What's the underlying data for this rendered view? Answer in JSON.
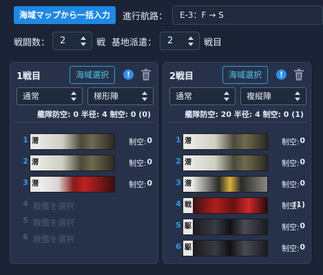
{
  "toolbar": {
    "import_button": "海域マップから一括入力",
    "route_label": "進行航路：",
    "route_value": "E-3：F → S",
    "battles_label": "戦闘数：",
    "battles_value": "2",
    "battles_suffix": "戦",
    "base_label": "基地派遣：",
    "base_value": "2",
    "base_suffix": "戦目"
  },
  "panels": [
    {
      "title": "1戦目",
      "area_button": "海域選択",
      "info_icon": "!",
      "mode": "通常",
      "formation": "梯形陣",
      "stats": "艦隊防空: 0  半径: 4  制空: 0 (0)",
      "ships": [
        {
          "index": "1",
          "badge": "潜",
          "aa_label": "制空:",
          "aa_value": "0"
        },
        {
          "index": "2",
          "badge": "潜",
          "aa_label": "制空:",
          "aa_value": "0"
        },
        {
          "index": "3",
          "badge": "潜",
          "aa_label": "制空:",
          "aa_value": "0"
        }
      ],
      "empty_slots": [
        {
          "index": "4",
          "label": "敵艦を選択"
        },
        {
          "index": "5",
          "label": "敵艦を選択"
        },
        {
          "index": "6",
          "label": "敵艦を選択"
        }
      ]
    },
    {
      "title": "2戦目",
      "area_button": "海域選択",
      "info_icon": "!",
      "mode": "通常",
      "formation": "複縦陣",
      "stats": "艦隊防空: 20  半径: 4  制空: 0 (1)",
      "ships": [
        {
          "index": "1",
          "badge": "潜",
          "aa_label": "制空:",
          "aa_value": "0"
        },
        {
          "index": "2",
          "badge": "潜",
          "aa_label": "制空:",
          "aa_value": "0"
        },
        {
          "index": "3",
          "badge": "潜",
          "aa_label": "制空:",
          "aa_value": "0"
        },
        {
          "index": "4",
          "badge": "戦",
          "aa_label": "制空:",
          "aa_value": "(1)"
        },
        {
          "index": "5",
          "badge": "駆",
          "aa_label": "制空:",
          "aa_value": "0"
        },
        {
          "index": "6",
          "badge": "駆",
          "aa_label": "制空:",
          "aa_value": "0"
        }
      ],
      "empty_slots": []
    }
  ],
  "colors": {
    "accent": "#1e88e5",
    "index_blue": "#2f9bf0",
    "outline_cyan": "#2aa3c9"
  }
}
